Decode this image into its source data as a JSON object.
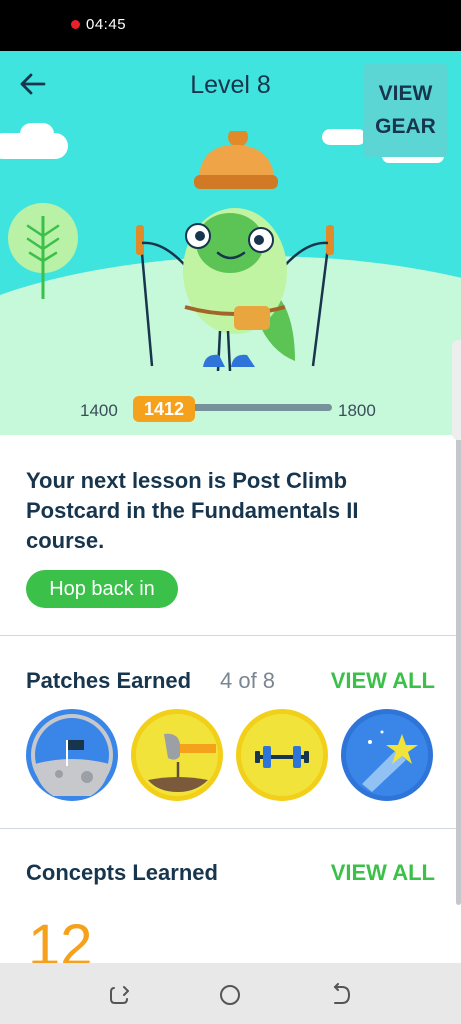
{
  "status_bar": {
    "time": "04:45"
  },
  "header": {
    "back_label": "←",
    "title": "Level 8",
    "view_gear_line1": "VIEW",
    "view_gear_line2": "GEAR"
  },
  "xp": {
    "min": "1400",
    "max": "1800",
    "current": "1412",
    "progress_fraction": 0.03
  },
  "next_lesson": {
    "text": "Your next lesson is Post Climb Postcard in the Fundamentals II course.",
    "button_label": "Hop back in"
  },
  "patches": {
    "title": "Patches Earned",
    "count": "4 of 8",
    "view_all": "VIEW ALL",
    "items": [
      {
        "icon": "moon-flag-icon",
        "color": "#3a86e8"
      },
      {
        "icon": "hammer-nail-icon",
        "color": "#f2e33a"
      },
      {
        "icon": "dumbbell-icon",
        "color": "#f2e33a"
      },
      {
        "icon": "shooting-star-icon",
        "color": "#3a86e8"
      }
    ]
  },
  "concepts": {
    "title": "Concepts Learned",
    "view_all": "VIEW ALL",
    "count": "12"
  },
  "colors": {
    "accent_green": "#3bc04a",
    "accent_orange": "#f5a11c",
    "hero_sky": "#3fe4df",
    "text_dark": "#17354d"
  }
}
